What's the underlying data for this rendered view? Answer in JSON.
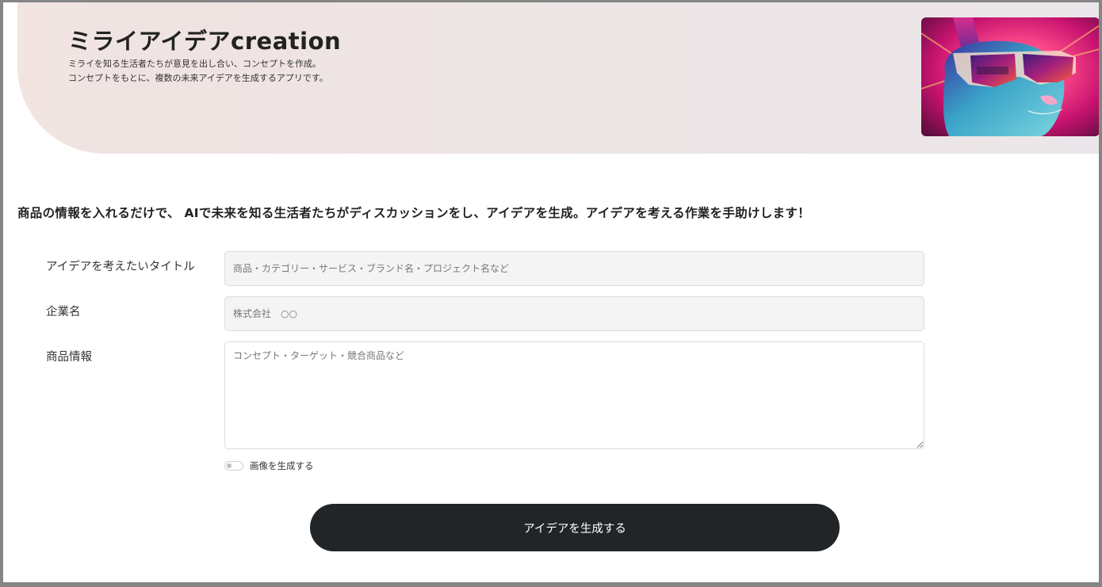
{
  "header": {
    "title": "ミライアイデアcreation",
    "subtitle_line1": "ミライを知る生活者たちが意見を出し合い、コンセプトを作成。",
    "subtitle_line2": "コンセプトをもとに、複数の未来アイデアを生成するアプリです。",
    "image_icon": "rabbit-with-sunglasses-illustration"
  },
  "tagline": "商品の情報を入れるだけで、 AIで未来を知る生活者たちがディスカッションをし、アイデアを生成。アイデアを考える作業を手助けします！",
  "form": {
    "title_label": "アイデアを考えたいタイトル",
    "title_placeholder": "商品・カテゴリー・サービス・ブランド名・プロジェクト名など",
    "company_label": "企業名",
    "company_placeholder": "株式会社　○○",
    "product_label": "商品情報",
    "product_placeholder": "コンセプト・ターゲット・競合商品など",
    "toggle_label": "画像を生成する",
    "toggle_on": false,
    "submit_label": "アイデアを生成する"
  },
  "colors": {
    "hero_bg": "#efe5e3",
    "button_bg": "#222528",
    "frame_border": "#858585"
  }
}
